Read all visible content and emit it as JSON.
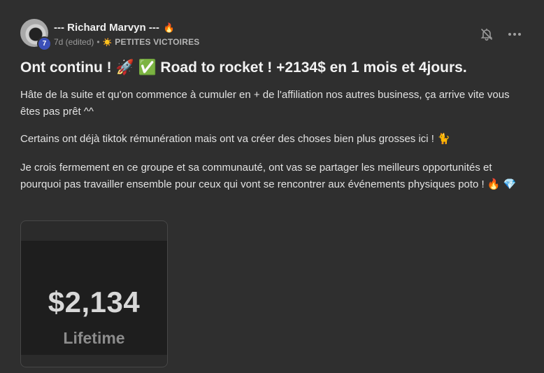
{
  "author": {
    "name": "--- Richard Marvyn ---",
    "flair": "🔥",
    "level": "7"
  },
  "meta": {
    "time": "7d (edited)",
    "separator": "•",
    "category_icon": "☀️",
    "category": "PETITES VICTOIRES"
  },
  "title": "Ont continu ! 🚀 ✅  Road to rocket ! +2134$ en 1 mois et 4jours.",
  "body": {
    "p1": "Hâte de la suite et qu'on commence à cumuler en + de l'affiliation nos autres business, ça arrive vite vous êtes pas prêt ^^",
    "p2": "Certains ont déjà tiktok rémunération mais ont va créer des choses bien plus grosses ici ! 🐈",
    "p3": "Je crois fermement en ce groupe et sa communauté, ont vas se partager les meilleurs opportunités et pourquoi pas travailler ensemble pour ceux qui vont se rencontrer aux événements physiques poto ! 🔥 💎"
  },
  "attachment": {
    "amount": "$2,134",
    "label": "Lifetime"
  },
  "icons": {
    "bell": "bell-off-icon",
    "more": "more-horizontal-icon"
  },
  "colors": {
    "background": "#2f2f2f",
    "level_badge": "#3b4fb8",
    "text": "#e2e2e2",
    "muted": "#9a9a9a"
  }
}
